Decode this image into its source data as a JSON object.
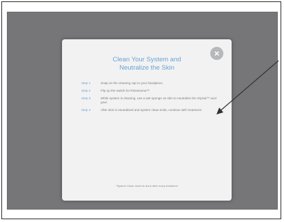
{
  "modal": {
    "title_line1": "Clean Your System and",
    "title_line2": "Neutralize the Skin",
    "close_glyph": "×",
    "steps": [
      {
        "label": "Step 1",
        "text": "Snap on the cleaning cap to your handpiece."
      },
      {
        "label": "Step 2",
        "text": "Flip up the switch for Rinsesoma™"
      },
      {
        "label": "Step 3",
        "text": "While system is cleaning, use a wet sponge on skin to neutralize the GlySal™ acid peel."
      },
      {
        "label": "Step 4",
        "text": "After skin is neutralized and system clean ends, continue with treatment."
      }
    ],
    "footnote": "*System Clean must be done after every treatment"
  },
  "colors": {
    "accent": "#6aa3d4",
    "screen_bg": "#767678",
    "modal_bg": "#f2f2f2",
    "close_bg": "#b7b8ba"
  }
}
